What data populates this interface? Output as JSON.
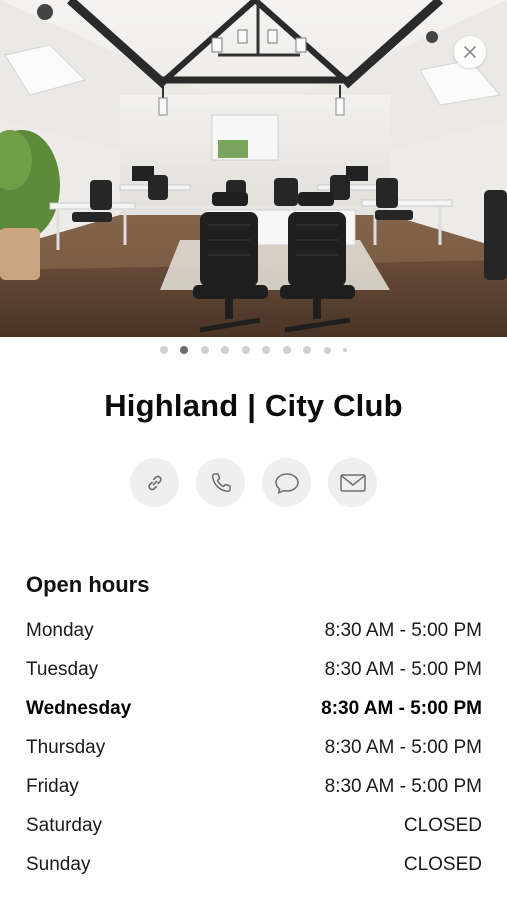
{
  "venue": {
    "name": "Highland | City Club"
  },
  "gallery": {
    "page_count": 10,
    "current_index": 1
  },
  "actions": [
    {
      "id": "link",
      "icon": "link-icon"
    },
    {
      "id": "phone",
      "icon": "phone-icon"
    },
    {
      "id": "message",
      "icon": "chat-bubble-icon"
    },
    {
      "id": "email",
      "icon": "envelope-icon"
    }
  ],
  "hours": {
    "title": "Open hours",
    "days": [
      {
        "day": "Monday",
        "time": "8:30 AM - 5:00 PM",
        "today": false
      },
      {
        "day": "Tuesday",
        "time": "8:30 AM - 5:00 PM",
        "today": false
      },
      {
        "day": "Wednesday",
        "time": "8:30 AM - 5:00 PM",
        "today": true
      },
      {
        "day": "Thursday",
        "time": "8:30 AM - 5:00 PM",
        "today": false
      },
      {
        "day": "Friday",
        "time": "8:30 AM - 5:00 PM",
        "today": false
      },
      {
        "day": "Saturday",
        "time": "CLOSED",
        "today": false
      },
      {
        "day": "Sunday",
        "time": "CLOSED",
        "today": false
      }
    ]
  }
}
